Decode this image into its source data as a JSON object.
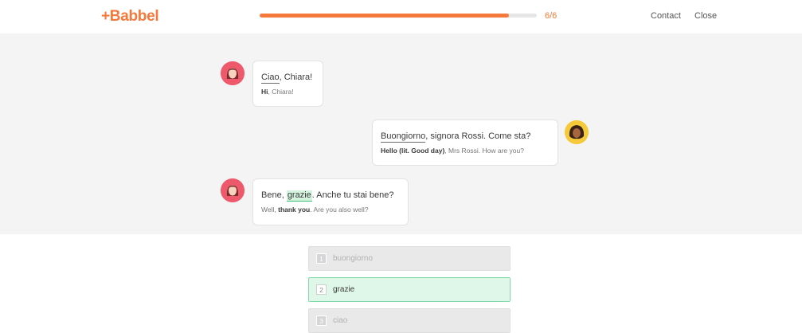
{
  "header": {
    "logo": "+Babbel",
    "progress_fraction": 0.9,
    "progress_text": "6/6",
    "contact": "Contact",
    "close": "Close"
  },
  "dialog": {
    "messages": [
      {
        "speaker": "Chiara",
        "line1_highlight": "Ciao",
        "line1_rest": ", Chiara!",
        "line2_bold": "Hi",
        "line2_rest": ", Chiara!"
      },
      {
        "speaker": "Mrs Rossi",
        "line1_highlight": "Buongiorno",
        "line1_rest": ", signora Rossi. Come sta?",
        "line2_bold": "Hello (lit. Good day)",
        "line2_rest": ", Mrs Rossi. How are you?"
      },
      {
        "speaker": "Chiara",
        "line1_before": "Bene, ",
        "line1_highlight": "grazie",
        "line1_rest": ". Anche tu stai bene?",
        "line2_before": "Well, ",
        "line2_bold": "thank you",
        "line2_rest": ". Are you also well?"
      }
    ]
  },
  "answers": [
    {
      "number": "1",
      "text": "buongiorno",
      "selected": false
    },
    {
      "number": "2",
      "text": "grazie",
      "selected": true
    },
    {
      "number": "3",
      "text": "ciao",
      "selected": false
    }
  ],
  "colors": {
    "brand": "#f4793b",
    "highlight": "#d3f3df",
    "selected_border": "#7fdba5"
  }
}
